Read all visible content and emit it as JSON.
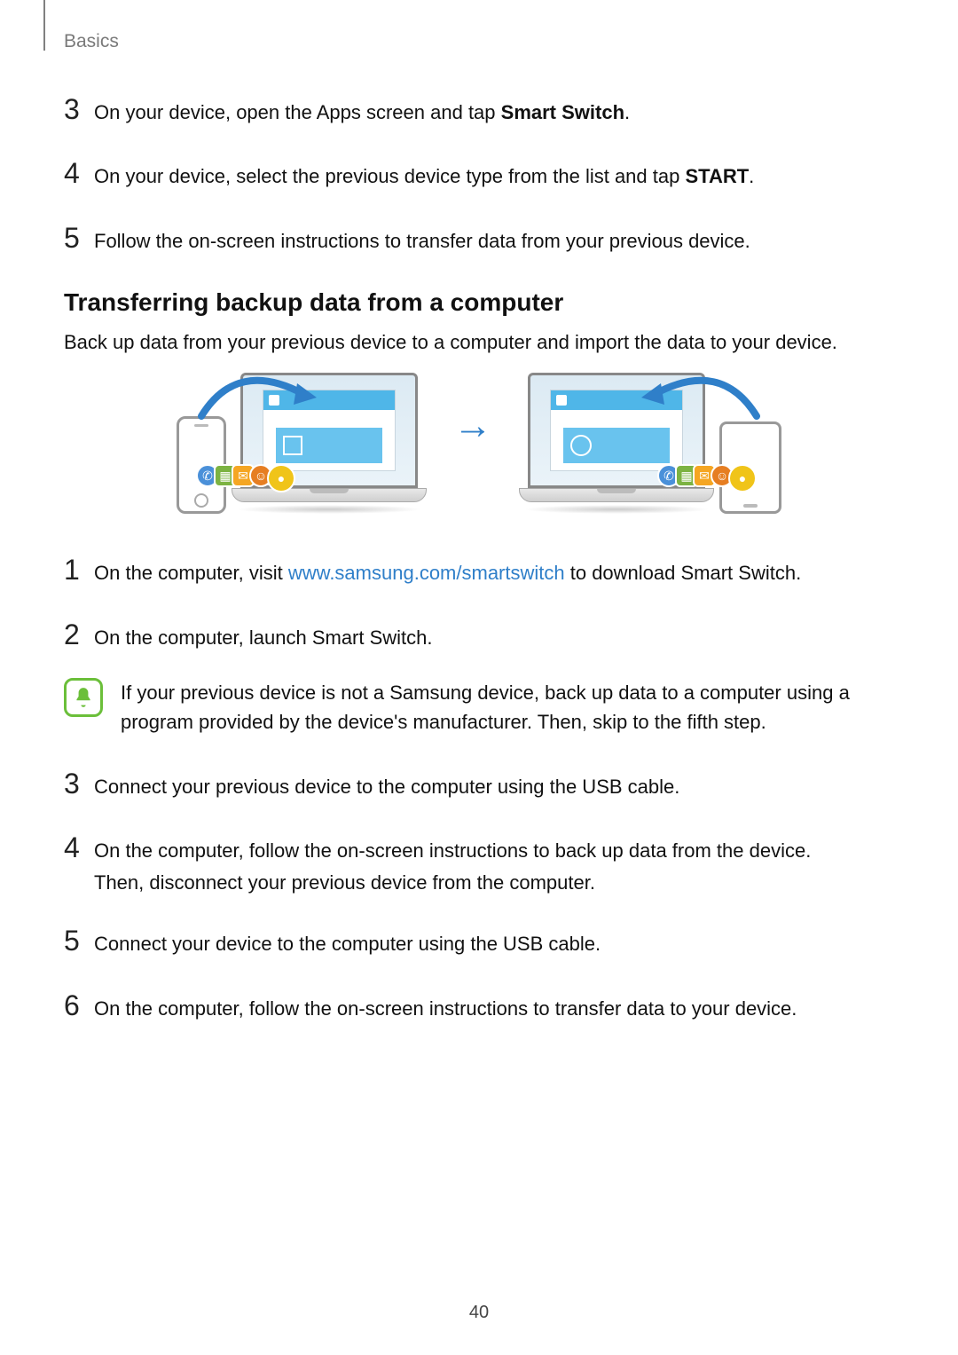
{
  "header": {
    "section_label": "Basics"
  },
  "steps_top": [
    {
      "num": "3",
      "text_pre": "On your device, open the Apps screen and tap ",
      "bold": "Smart Switch",
      "text_post": "."
    },
    {
      "num": "4",
      "text_pre": "On your device, select the previous device type from the list and tap ",
      "bold": "START",
      "text_post": "."
    },
    {
      "num": "5",
      "text_pre": "Follow the on-screen instructions to transfer data from your previous device.",
      "bold": "",
      "text_post": ""
    }
  ],
  "section": {
    "heading": "Transferring backup data from a computer",
    "intro": "Back up data from your previous device to a computer and import the data to your device."
  },
  "link": {
    "url_text": "www.samsung.com/smartswitch"
  },
  "steps_bottom": {
    "s1_pre": "On the computer, visit ",
    "s1_post": " to download Smart Switch.",
    "s2": "On the computer, launch Smart Switch.",
    "note": "If your previous device is not a Samsung device, back up data to a computer using a program provided by the device's manufacturer. Then, skip to the fifth step.",
    "s3": "Connect your previous device to the computer using the USB cable.",
    "s4_line1": "On the computer, follow the on-screen instructions to back up data from the device.",
    "s4_line2": "Then, disconnect your previous device from the computer.",
    "s5": "Connect your device to the computer using the USB cable.",
    "s6": "On the computer, follow the on-screen instructions to transfer data to your device."
  },
  "nums": {
    "n1": "1",
    "n2": "2",
    "n3": "3",
    "n4": "4",
    "n5": "5",
    "n6": "6"
  },
  "page_number": "40",
  "arrow_glyph": "→"
}
